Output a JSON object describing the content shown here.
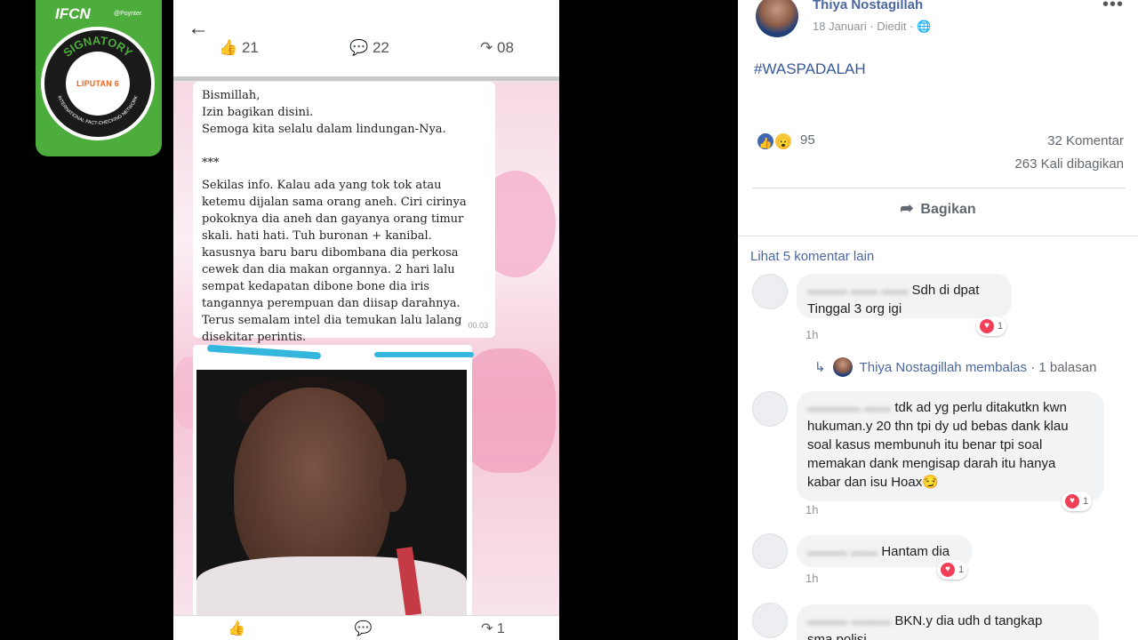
{
  "badge": {
    "org": "IFCN",
    "by": "@Poynter.",
    "ring_top": "SIGNATORY",
    "ring_bottom": "INTERNATIONAL FACT-CHECKING NETWORK",
    "member": "LIPUTAN 6"
  },
  "phone": {
    "reaction_counts": [
      "21",
      "22",
      "08"
    ],
    "message_lines_1": [
      "Bismillah,",
      "Izin bagikan disini.",
      "Semoga kita selalu dalam lindungan-Nya."
    ],
    "ellipsis": "***",
    "message_body": "Sekilas info.  Kalau ada yang tok tok atau ketemu dijalan sama orang aneh.  Ciri cirinya pokoknya dia aneh dan gayanya orang timur skali.  hati hati.  Tuh buronan + kanibal.  kasusnya baru baru dibombana dia perkosa cewek dan dia makan organnya.  2 hari lalu sempat kedapatan dibone bone dia iris tangannya perempuan dan diisap darahnya. Terus semalam intel dia temukan lalu lalang disekitar perintis.",
    "message_time": "00.03",
    "bottom_count": "1"
  },
  "post": {
    "author": "Thiya Nostagillah",
    "date": "18 Januari",
    "edited": "Diedit",
    "text": "#WASPADALAH",
    "reaction_count": "95",
    "comment_count": "32 Komentar",
    "share_count": "263 Kali dibagikan",
    "share_label": "Bagikan",
    "view_more": "Lihat 5 komentar lain"
  },
  "comments": [
    {
      "name": "",
      "text_line1": "Sdh di dpat",
      "text_line2": "Tinggal 3 org igi",
      "time": "1h",
      "hearts": "1"
    },
    {
      "name": "",
      "text_line1": "tdk ad yg perlu ditakutkn kwn",
      "text_line2": "hukuman.y 20 thn tpi dy ud bebas dank klau",
      "text_line3": "soal kasus membunuh itu benar tpi soal",
      "text_line4": "memakan dank mengisap darah itu hanya",
      "text_line5": "kabar dan isu Hoax😏",
      "time": "1h",
      "hearts": "1"
    },
    {
      "name": "",
      "text_line1": "Hantam dia",
      "time": "1h",
      "hearts": "1"
    },
    {
      "name": "",
      "text_line1": "BKN.y dia udh d tangkap",
      "text_line2": "sma polisi"
    }
  ],
  "reply": {
    "name": "Thiya Nostagillah",
    "action": "membalas",
    "sep": "·",
    "count": "1 balasan"
  },
  "colors": {
    "fb_link": "#4b67a1",
    "badge_green": "#4cad3c",
    "heart": "#f33e58"
  },
  "icons": [
    "back-arrow-icon",
    "like-icon",
    "wow-icon",
    "share-icon",
    "globe-icon",
    "more-icon",
    "reply-arrow-icon",
    "heart-icon"
  ]
}
